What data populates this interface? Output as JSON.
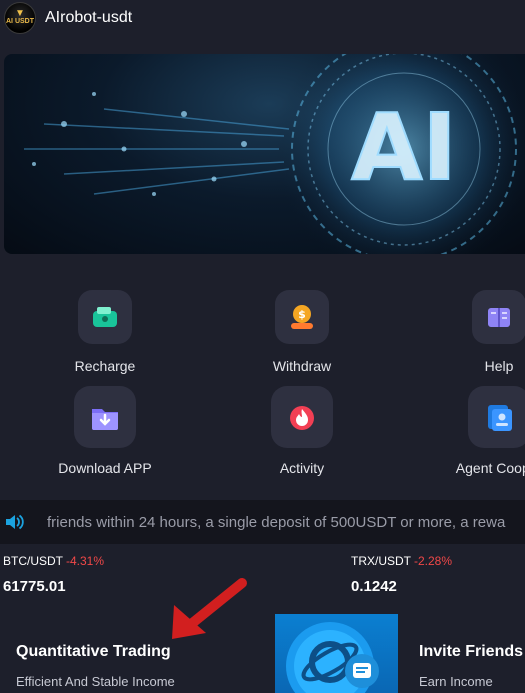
{
  "app": {
    "title": "AIrobot-usdt",
    "logo_text": "AI USDT"
  },
  "banner": {
    "text": "AI"
  },
  "menu": [
    {
      "label": "Recharge",
      "icon": "wallet-icon"
    },
    {
      "label": "Withdraw",
      "icon": "coin-hand-icon"
    },
    {
      "label": "Help",
      "icon": "book-icon"
    },
    {
      "label": "Download APP",
      "icon": "download-folder-icon"
    },
    {
      "label": "Activity",
      "icon": "fire-icon"
    },
    {
      "label": "Agent Cooper",
      "icon": "agent-card-icon"
    }
  ],
  "notice": {
    "text": "friends within 24 hours, a single deposit of 500USDT or more, a rewa",
    "icon": "speaker-icon"
  },
  "markets": [
    {
      "pair": "BTC/USDT",
      "change": "-4.31%",
      "price": "61775.01"
    },
    {
      "pair": "TRX/USDT",
      "change": "-2.28%",
      "price": "0.1242"
    }
  ],
  "cards": [
    {
      "title": "Quantitative Trading",
      "subtitle": "Efficient And Stable Income"
    },
    {
      "title": "Invite Friends",
      "subtitle": "Earn Income"
    }
  ],
  "colors": {
    "background": "#1d1f2b",
    "negative": "#f04848",
    "accent": "#0b7fd1",
    "arrow": "#d21f1f"
  }
}
